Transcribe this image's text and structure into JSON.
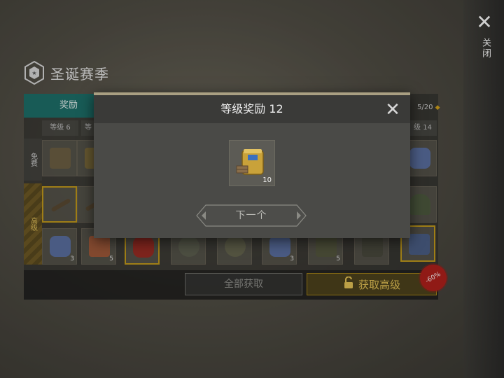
{
  "side": {
    "close_label": "关闭"
  },
  "season": {
    "title": "圣诞赛季"
  },
  "tabs": {
    "rewards": "奖励"
  },
  "progress": {
    "text": "5/20"
  },
  "levels": [
    {
      "label": "等级 6"
    },
    {
      "label": "等"
    },
    {
      "label": "级 14"
    }
  ],
  "side_tabs": {
    "free": "免费",
    "advanced": "高级"
  },
  "free_row": [
    {
      "qty": ""
    },
    {
      "qty": ""
    },
    {
      "qty": ""
    }
  ],
  "advanced_row_top": [
    {
      "qty": ""
    },
    {
      "qty": ""
    },
    {
      "qty": ""
    }
  ],
  "advanced_row_bottom": [
    {
      "qty": "3"
    },
    {
      "qty": "5"
    },
    {
      "qty": ""
    },
    {
      "qty": ""
    },
    {
      "qty": ""
    },
    {
      "qty": "3"
    },
    {
      "qty": "5"
    },
    {
      "qty": ""
    },
    {
      "qty": ""
    }
  ],
  "buttons": {
    "claim_all": "全部获取",
    "get_advanced": "获取高级",
    "discount": "-60%"
  },
  "modal": {
    "title": "等级奖励 12",
    "reward_qty": "10",
    "next_label": "下一个"
  },
  "colors": {
    "teal_tab": "#1e6f6a",
    "gold_accent": "#c29a1b",
    "discount_red": "#b0201c"
  }
}
